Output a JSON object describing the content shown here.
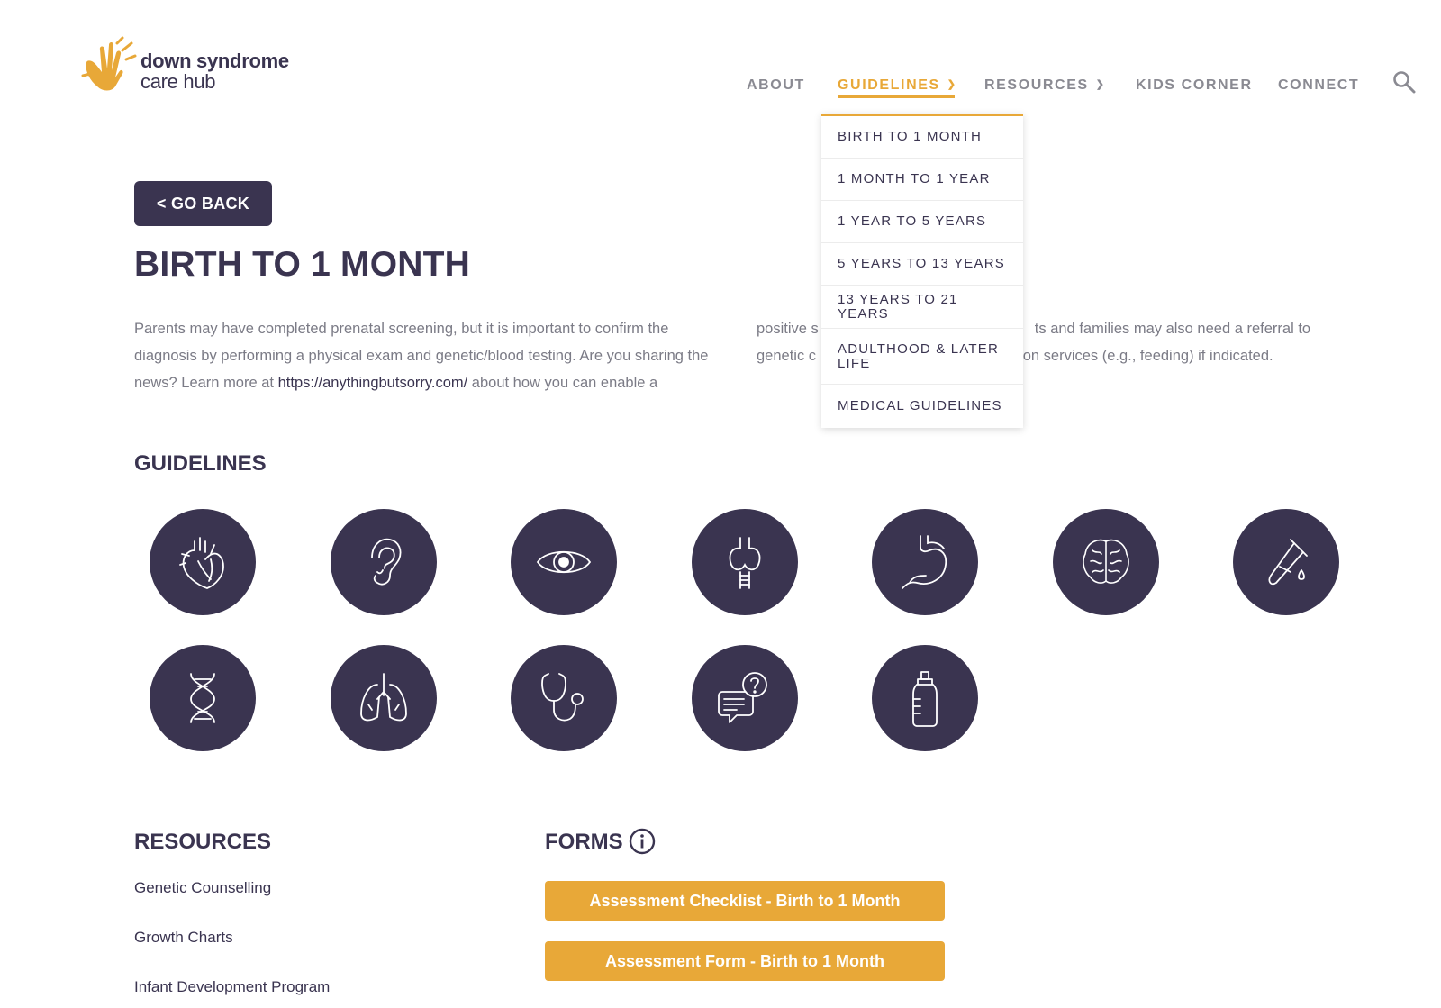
{
  "logo": {
    "line1": "down syndrome",
    "line2": "care hub",
    "brand_color": "#e8a838"
  },
  "nav": {
    "items": [
      {
        "label": "ABOUT",
        "has_dropdown": false
      },
      {
        "label": "GUIDELINES",
        "has_dropdown": true,
        "active": true
      },
      {
        "label": "RESOURCES",
        "has_dropdown": true
      },
      {
        "label": "KIDS CORNER",
        "has_dropdown": false
      },
      {
        "label": "CONNECT",
        "has_dropdown": false
      }
    ],
    "search_icon": "search-icon",
    "active_color": "#e8a838"
  },
  "dropdown": {
    "items": [
      "BIRTH TO 1 MONTH",
      "1 MONTH TO 1 YEAR",
      "1 YEAR TO 5 YEARS",
      "5 YEARS TO 13 YEARS",
      "13 YEARS TO 21 YEARS",
      "ADULTHOOD & LATER LIFE",
      "MEDICAL GUIDELINES"
    ]
  },
  "main": {
    "go_back_label": "< GO BACK",
    "title": "BIRTH TO 1 MONTH",
    "intro_col1_before_link": "Parents may have completed prenatal screening, but it is important to confirm the diagnosis by performing a physical exam and genetic/blood testing. Are you sharing the news? Learn more at ",
    "intro_link": "https://anythingbutsorry.com/",
    "intro_col1_after_link": " about how you can enable a",
    "intro_col2_line1_a": "positive s",
    "intro_col2_line1_b": "ts and families may also need a referral to",
    "intro_col2_line2_a": "genetic c",
    "intro_col2_line2_b": "ion services (e.g., feeding) if indicated.",
    "guidelines_heading": "GUIDELINES",
    "guideline_icons": [
      "heart-icon",
      "ear-icon",
      "eye-icon",
      "thyroid-icon",
      "stomach-icon",
      "brain-icon",
      "test-tube-icon",
      "dna-icon",
      "lungs-icon",
      "stethoscope-icon",
      "chat-question-icon",
      "baby-bottle-icon"
    ],
    "resources_heading": "RESOURCES",
    "resources": [
      "Genetic Counselling",
      "Growth Charts",
      "Infant Development Program"
    ],
    "forms_heading": "FORMS",
    "forms": [
      "Assessment Checklist - Birth to 1 Month",
      "Assessment Form - Birth to 1 Month"
    ],
    "primary_color": "#3a3450",
    "button_color": "#e8a838"
  }
}
